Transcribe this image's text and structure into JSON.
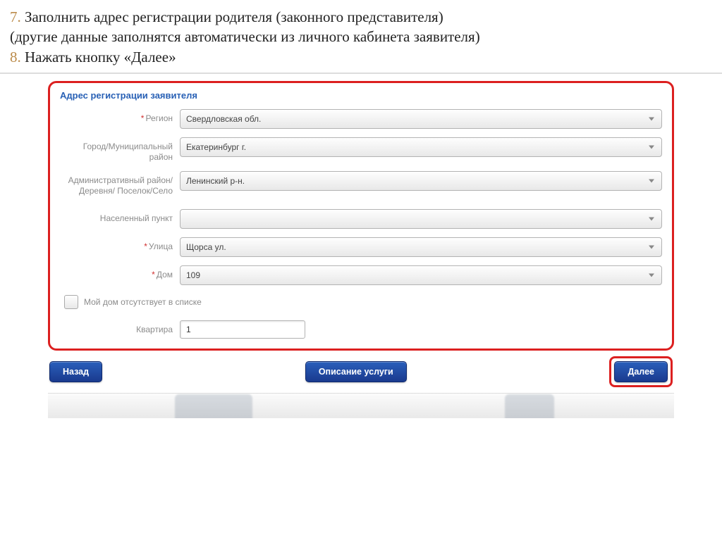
{
  "instructions": {
    "line1_num": "7.",
    "line1_text": " Заполнить адрес регистрации родителя (законного представителя)",
    "line2_text": "(другие данные заполнятся автоматически из личного кабинета заявителя)",
    "line3_num": "8.",
    "line3_text": " Нажать кнопку «Далее»"
  },
  "form": {
    "section_title": "Адрес регистрации заявителя",
    "fields": {
      "region": {
        "label": "Регион",
        "required": true,
        "value": "Свердловская обл."
      },
      "city": {
        "label": "Город/Муниципальный район",
        "required": false,
        "value": "Екатеринбург г."
      },
      "admin_district": {
        "label": "Административный район/Деревня/ Поселок/Село",
        "required": false,
        "value": "Ленинский р-н."
      },
      "locality": {
        "label": "Населенный пункт",
        "required": false,
        "value": ""
      },
      "street": {
        "label": "Улица",
        "required": true,
        "value": "Щорса ул."
      },
      "house": {
        "label": "Дом",
        "required": true,
        "value": "109"
      },
      "apartment": {
        "label": "Квартира",
        "required": false,
        "value": "1"
      }
    },
    "checkbox_label": "Мой дом отсутствует в списке"
  },
  "buttons": {
    "back": "Назад",
    "describe": "Описание услуги",
    "next": "Далее"
  }
}
